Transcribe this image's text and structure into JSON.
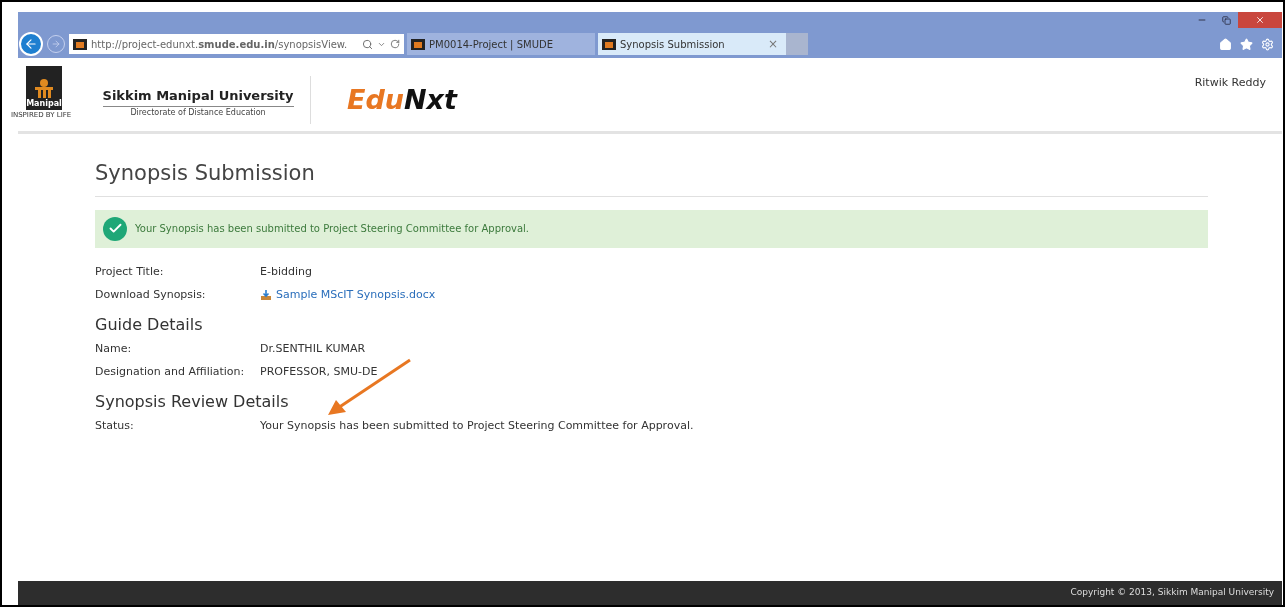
{
  "browser": {
    "address": "http://project-edunxt.**smude.edu.in**/synopsisView.",
    "tabs": [
      {
        "label": "PM0014-Project | SMUDE",
        "selected": false
      },
      {
        "label": "Synopsis Submission",
        "selected": true,
        "close": "×"
      }
    ]
  },
  "header": {
    "logo_word": "Manipal",
    "logo_tagline": "INSPIRED BY LIFE",
    "university": "Sikkim Manipal University",
    "directorate": "Directorate of Distance Education",
    "brand_first": "Edu",
    "brand_second": "Nxt",
    "user": "Ritwik Reddy"
  },
  "page": {
    "title": "Synopsis Submission",
    "alert": "Your Synopsis has been submitted to Project Steering Committee for Approval.",
    "project": [
      {
        "label": "Project Title:",
        "value": "E-bidding",
        "kind": "text"
      },
      {
        "label": "Download Synopsis:",
        "value": "Sample MScIT Synopsis.docx",
        "kind": "link"
      }
    ],
    "guide_heading": "Guide Details",
    "guide": [
      {
        "label": "Name:",
        "value": "Dr.SENTHIL KUMAR",
        "kind": "text"
      },
      {
        "label": "Designation and Affiliation:",
        "value": "PROFESSOR, SMU-DE",
        "kind": "text"
      }
    ],
    "review_heading": "Synopsis Review Details",
    "review": [
      {
        "label": "Status:",
        "value": "Your Synopsis has been submitted to Project Steering Committee for Approval.",
        "kind": "text"
      }
    ]
  },
  "footer": "Copyright © 2013, Sikkim Manipal University"
}
